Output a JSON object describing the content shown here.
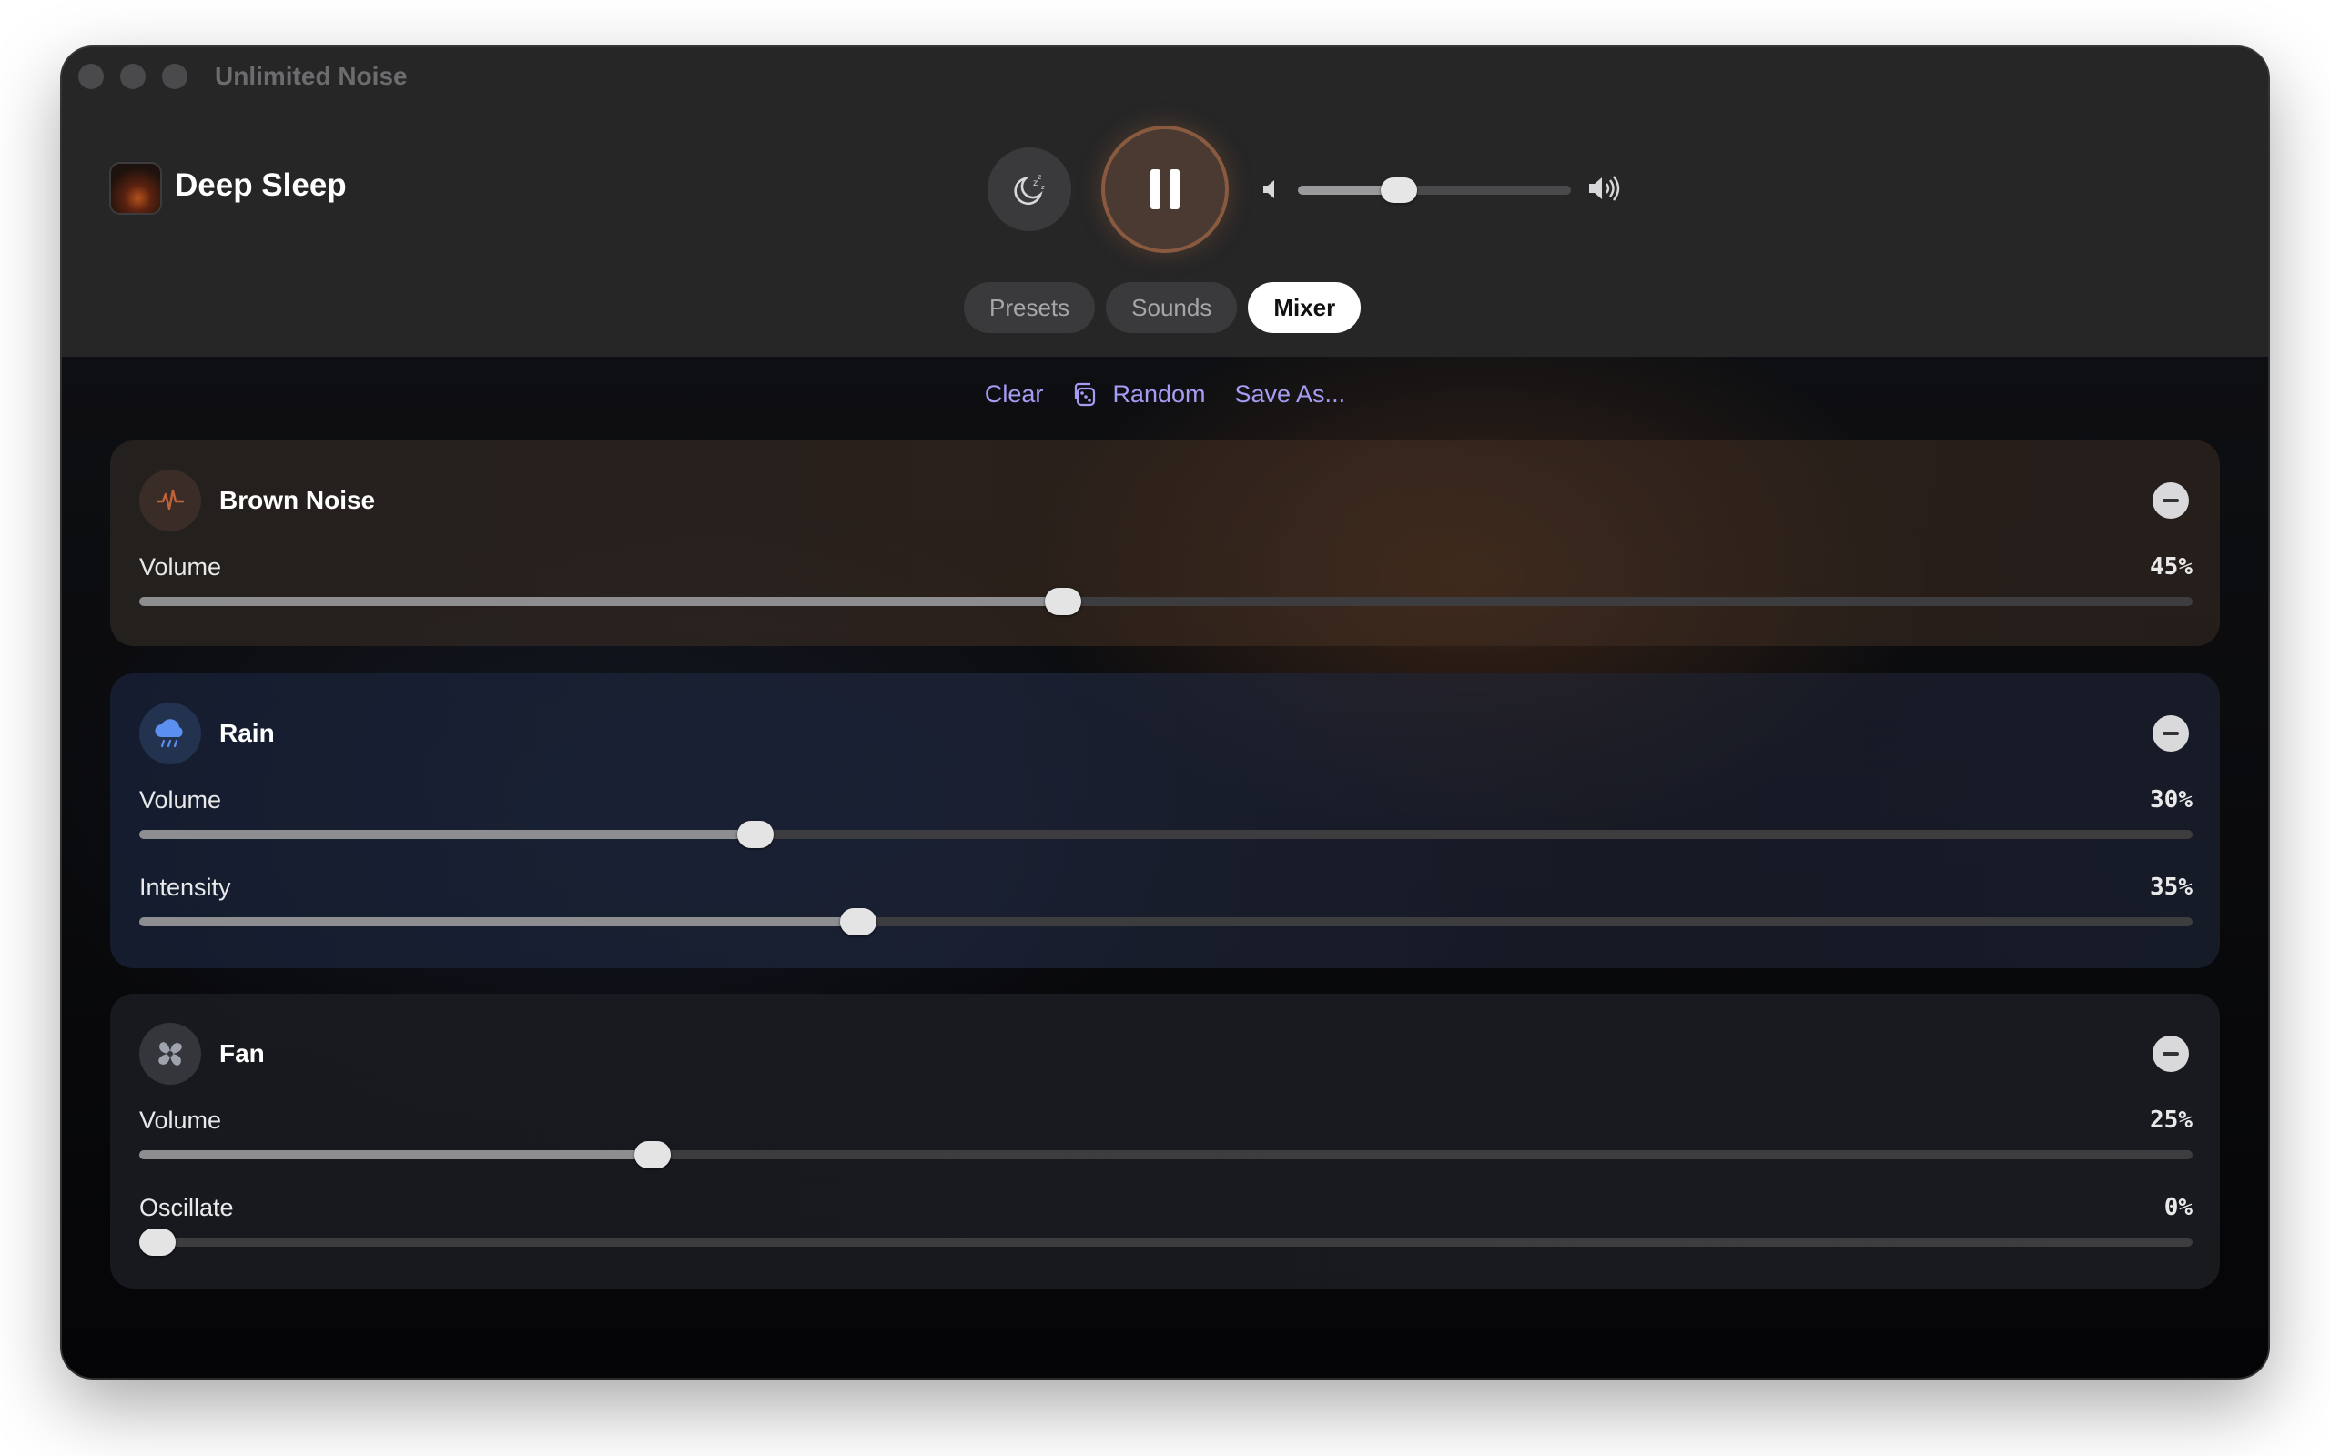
{
  "window": {
    "title": "Unlimited Noise"
  },
  "now_playing": {
    "title": "Deep Sleep"
  },
  "master_volume": {
    "level": 0.37
  },
  "tabs": [
    {
      "label": "Presets",
      "active": false
    },
    {
      "label": "Sounds",
      "active": false
    },
    {
      "label": "Mixer",
      "active": true
    }
  ],
  "actions": {
    "clear": "Clear",
    "random": "Random",
    "save_as": "Save As..."
  },
  "sounds": [
    {
      "name": "Brown Noise",
      "icon": "waveform-icon",
      "params": [
        {
          "label": "Volume",
          "value": "45%",
          "level": 0.45
        }
      ]
    },
    {
      "name": "Rain",
      "icon": "cloud-rain-icon",
      "params": [
        {
          "label": "Volume",
          "value": "30%",
          "level": 0.3
        },
        {
          "label": "Intensity",
          "value": "35%",
          "level": 0.35
        }
      ]
    },
    {
      "name": "Fan",
      "icon": "fan-icon",
      "params": [
        {
          "label": "Volume",
          "value": "25%",
          "level": 0.25
        },
        {
          "label": "Oscillate",
          "value": "0%",
          "level": 0.0
        }
      ]
    }
  ],
  "colors": {
    "accent": "#a59cf3",
    "brown_noise": "#c0623a",
    "rain": "#5b8ff0"
  }
}
